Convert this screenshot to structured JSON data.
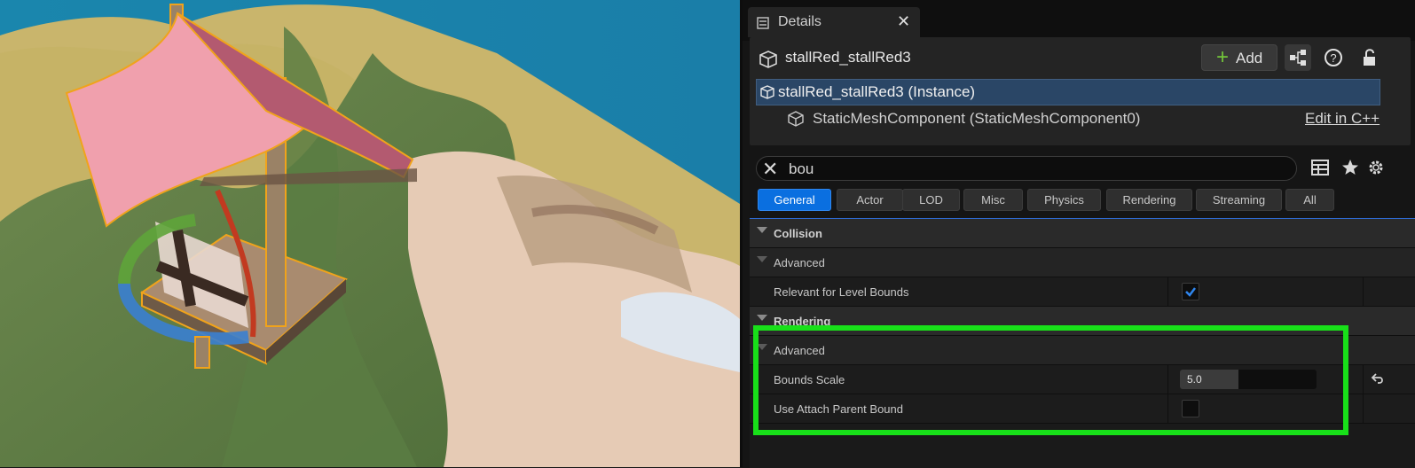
{
  "viewport": {
    "description_icon": "viewport-3d-scene"
  },
  "details_tab": {
    "title": "Details",
    "close": "✕"
  },
  "header": {
    "actor_name": "stallRed_stallRed3",
    "add_label": "Add",
    "instance_label": "stallRed_stallRed3 (Instance)",
    "component_label": "StaticMeshComponent (StaticMeshComponent0)",
    "edit_cpp": "Edit in C++"
  },
  "search": {
    "value": "bou",
    "placeholder": ""
  },
  "filter_tabs": [
    "General",
    "Actor",
    "LOD",
    "Misc",
    "Physics",
    "Rendering",
    "Streaming",
    "All"
  ],
  "properties": {
    "collision": "Collision",
    "collision_advanced": "Advanced",
    "relevant_bounds": "Relevant for Level Bounds",
    "relevant_bounds_checked": true,
    "rendering": "Rendering",
    "rendering_advanced": "Advanced",
    "bounds_scale": "Bounds Scale",
    "bounds_scale_value": "5.0",
    "use_attach_parent": "Use Attach Parent Bound",
    "use_attach_parent_checked": false
  },
  "colors": {
    "accent": "#0a6fe0",
    "highlight": "#18e019",
    "add_plus": "#73c53a"
  }
}
